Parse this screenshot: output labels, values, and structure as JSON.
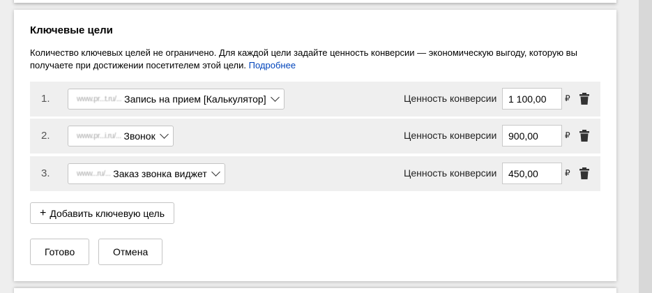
{
  "section": {
    "title": "Ключевые цели",
    "description": "Количество ключевых целей не ограничено. Для каждой цели задайте ценность конверсии — экономическую выгоду, которую вы получаете при достижении посетителем этой цели.",
    "more_link": "Подробнее"
  },
  "goals": [
    {
      "number": "1.",
      "site_masked": "www.pr...t.ru/...",
      "name": "Запись на прием [Калькулятор]",
      "conversion_label": "Ценность конверсии",
      "value": "1 100,00",
      "currency": "₽"
    },
    {
      "number": "2.",
      "site_masked": "www.pr...i.ru/...",
      "name": "Звонок",
      "conversion_label": "Ценность конверсии",
      "value": "900,00",
      "currency": "₽"
    },
    {
      "number": "3.",
      "site_masked": "www...ru/...",
      "name": "Заказ звонка виджет",
      "conversion_label": "Ценность конверсии",
      "value": "450,00",
      "currency": "₽"
    }
  ],
  "add_goal_button": {
    "icon": "+",
    "label": "Добавить ключевую цель"
  },
  "done_button": "Готово",
  "cancel_button": "Отмена",
  "icons": {
    "trash": "trash-icon",
    "chevron": "chevron-down-icon"
  }
}
